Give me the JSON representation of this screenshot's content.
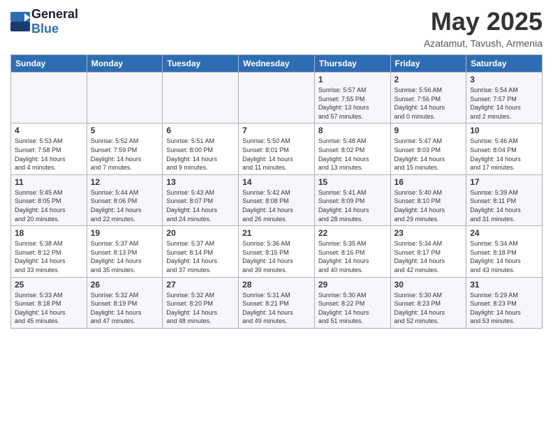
{
  "logo": {
    "general": "General",
    "blue": "Blue"
  },
  "title": "May 2025",
  "location": "Azatamut, Tavush, Armenia",
  "days_header": [
    "Sunday",
    "Monday",
    "Tuesday",
    "Wednesday",
    "Thursday",
    "Friday",
    "Saturday"
  ],
  "weeks": [
    [
      {
        "day": "",
        "info": ""
      },
      {
        "day": "",
        "info": ""
      },
      {
        "day": "",
        "info": ""
      },
      {
        "day": "",
        "info": ""
      },
      {
        "day": "1",
        "info": "Sunrise: 5:57 AM\nSunset: 7:55 PM\nDaylight: 13 hours\nand 57 minutes."
      },
      {
        "day": "2",
        "info": "Sunrise: 5:56 AM\nSunset: 7:56 PM\nDaylight: 14 hours\nand 0 minutes."
      },
      {
        "day": "3",
        "info": "Sunrise: 5:54 AM\nSunset: 7:57 PM\nDaylight: 14 hours\nand 2 minutes."
      }
    ],
    [
      {
        "day": "4",
        "info": "Sunrise: 5:53 AM\nSunset: 7:58 PM\nDaylight: 14 hours\nand 4 minutes."
      },
      {
        "day": "5",
        "info": "Sunrise: 5:52 AM\nSunset: 7:59 PM\nDaylight: 14 hours\nand 7 minutes."
      },
      {
        "day": "6",
        "info": "Sunrise: 5:51 AM\nSunset: 8:00 PM\nDaylight: 14 hours\nand 9 minutes."
      },
      {
        "day": "7",
        "info": "Sunrise: 5:50 AM\nSunset: 8:01 PM\nDaylight: 14 hours\nand 11 minutes."
      },
      {
        "day": "8",
        "info": "Sunrise: 5:48 AM\nSunset: 8:02 PM\nDaylight: 14 hours\nand 13 minutes."
      },
      {
        "day": "9",
        "info": "Sunrise: 5:47 AM\nSunset: 8:03 PM\nDaylight: 14 hours\nand 15 minutes."
      },
      {
        "day": "10",
        "info": "Sunrise: 5:46 AM\nSunset: 8:04 PM\nDaylight: 14 hours\nand 17 minutes."
      }
    ],
    [
      {
        "day": "11",
        "info": "Sunrise: 5:45 AM\nSunset: 8:05 PM\nDaylight: 14 hours\nand 20 minutes."
      },
      {
        "day": "12",
        "info": "Sunrise: 5:44 AM\nSunset: 8:06 PM\nDaylight: 14 hours\nand 22 minutes."
      },
      {
        "day": "13",
        "info": "Sunrise: 5:43 AM\nSunset: 8:07 PM\nDaylight: 14 hours\nand 24 minutes."
      },
      {
        "day": "14",
        "info": "Sunrise: 5:42 AM\nSunset: 8:08 PM\nDaylight: 14 hours\nand 26 minutes."
      },
      {
        "day": "15",
        "info": "Sunrise: 5:41 AM\nSunset: 8:09 PM\nDaylight: 14 hours\nand 28 minutes."
      },
      {
        "day": "16",
        "info": "Sunrise: 5:40 AM\nSunset: 8:10 PM\nDaylight: 14 hours\nand 29 minutes."
      },
      {
        "day": "17",
        "info": "Sunrise: 5:39 AM\nSunset: 8:11 PM\nDaylight: 14 hours\nand 31 minutes."
      }
    ],
    [
      {
        "day": "18",
        "info": "Sunrise: 5:38 AM\nSunset: 8:12 PM\nDaylight: 14 hours\nand 33 minutes."
      },
      {
        "day": "19",
        "info": "Sunrise: 5:37 AM\nSunset: 8:13 PM\nDaylight: 14 hours\nand 35 minutes."
      },
      {
        "day": "20",
        "info": "Sunrise: 5:37 AM\nSunset: 8:14 PM\nDaylight: 14 hours\nand 37 minutes."
      },
      {
        "day": "21",
        "info": "Sunrise: 5:36 AM\nSunset: 8:15 PM\nDaylight: 14 hours\nand 39 minutes."
      },
      {
        "day": "22",
        "info": "Sunrise: 5:35 AM\nSunset: 8:16 PM\nDaylight: 14 hours\nand 40 minutes."
      },
      {
        "day": "23",
        "info": "Sunrise: 5:34 AM\nSunset: 8:17 PM\nDaylight: 14 hours\nand 42 minutes."
      },
      {
        "day": "24",
        "info": "Sunrise: 5:34 AM\nSunset: 8:18 PM\nDaylight: 14 hours\nand 43 minutes."
      }
    ],
    [
      {
        "day": "25",
        "info": "Sunrise: 5:33 AM\nSunset: 8:18 PM\nDaylight: 14 hours\nand 45 minutes."
      },
      {
        "day": "26",
        "info": "Sunrise: 5:32 AM\nSunset: 8:19 PM\nDaylight: 14 hours\nand 47 minutes."
      },
      {
        "day": "27",
        "info": "Sunrise: 5:32 AM\nSunset: 8:20 PM\nDaylight: 14 hours\nand 48 minutes."
      },
      {
        "day": "28",
        "info": "Sunrise: 5:31 AM\nSunset: 8:21 PM\nDaylight: 14 hours\nand 49 minutes."
      },
      {
        "day": "29",
        "info": "Sunrise: 5:30 AM\nSunset: 8:22 PM\nDaylight: 14 hours\nand 51 minutes."
      },
      {
        "day": "30",
        "info": "Sunrise: 5:30 AM\nSunset: 8:23 PM\nDaylight: 14 hours\nand 52 minutes."
      },
      {
        "day": "31",
        "info": "Sunrise: 5:29 AM\nSunset: 8:23 PM\nDaylight: 14 hours\nand 53 minutes."
      }
    ]
  ]
}
